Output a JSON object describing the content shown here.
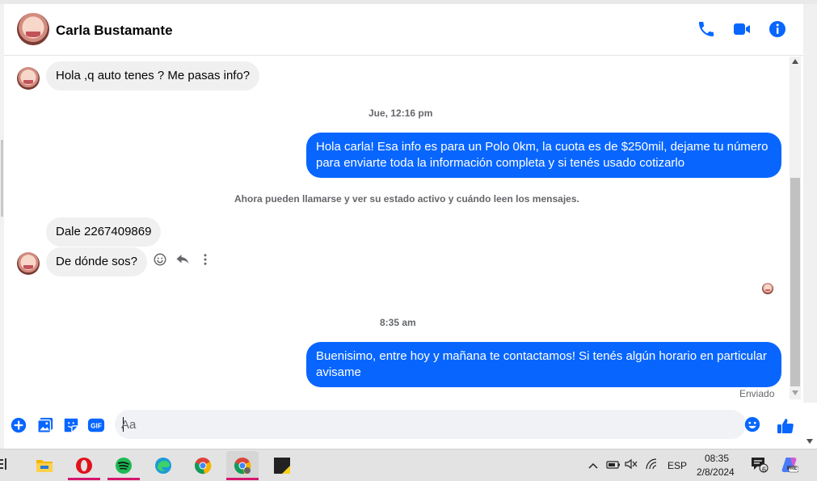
{
  "header": {
    "contact_name": "Carla Bustamante",
    "icons": [
      "phone-icon",
      "video-camera-icon",
      "info-icon"
    ]
  },
  "messages": {
    "m1": "Hola ,q auto tenes ? Me pasas info?",
    "ts1": "Jue, 12:16 pm",
    "m2": "Hola carla! Esa info es para un Polo 0km, la cuota es de $250mil, dejame tu número para enviarte toda la información completa y si tenés usado cotizarlo",
    "system": "Ahora pueden llamarse y ver su estado activo y cuándo leen los mensajes.",
    "m3": "Dale 2267409869",
    "m4": "De dónde sos?",
    "ts2": "8:35 am",
    "m5": "Buenisimo, entre hoy y mañana te contactamos! Si tenés algún horario en particular avisame",
    "status": "Enviado"
  },
  "composer": {
    "placeholder": "Aa",
    "icons": [
      "add-icon",
      "photo-icon",
      "sticker-icon",
      "gif-icon",
      "emoji-icon",
      "like-icon"
    ],
    "gif_label": "GIF"
  },
  "taskbar": {
    "apps": [
      "file-explorer-icon",
      "opera-icon",
      "spotify-icon",
      "edge-icon",
      "chrome-icon",
      "chrome-profile-icon",
      "sticky-notes-icon"
    ],
    "language": "ESP",
    "time": "08:35",
    "date": "2/8/2024",
    "notifications_count": "6",
    "copilot_badge": "PRE"
  },
  "colors": {
    "accent": "#0866ff",
    "incoming_bubble": "#f0f0f0",
    "secondary_text": "#65676b",
    "taskbar_indicator": "#d4166e"
  }
}
